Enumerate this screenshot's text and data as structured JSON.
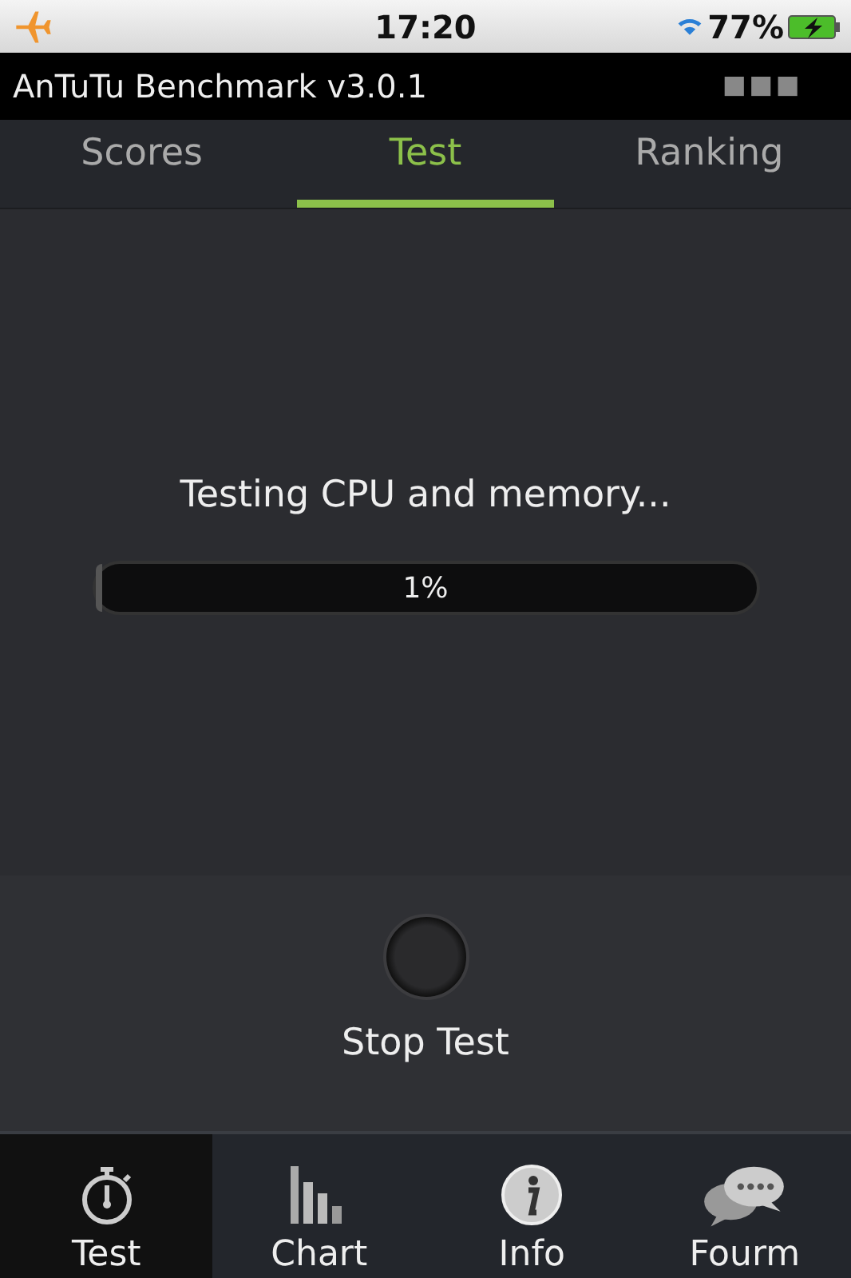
{
  "status_bar": {
    "time": "17:20",
    "battery": "77%"
  },
  "app_bar": {
    "title": "AnTuTu Benchmark v3.0.1"
  },
  "tabs": [
    {
      "label": "Scores",
      "selected": false
    },
    {
      "label": "Test",
      "selected": true
    },
    {
      "label": "Ranking",
      "selected": false
    }
  ],
  "progress": {
    "message": "Testing CPU and memory...",
    "level": 0.01,
    "reading": "1%"
  },
  "stop_button": {
    "label": "Stop Test"
  },
  "bottom_nav": [
    {
      "label": "Test",
      "kind": "stopwatch",
      "selected": true
    },
    {
      "label": "Chart",
      "kind": "chart",
      "selected": false
    },
    {
      "label": "Info",
      "kind": "info",
      "selected": false
    },
    {
      "label": "Fourm",
      "kind": "chat",
      "selected": false
    }
  ]
}
